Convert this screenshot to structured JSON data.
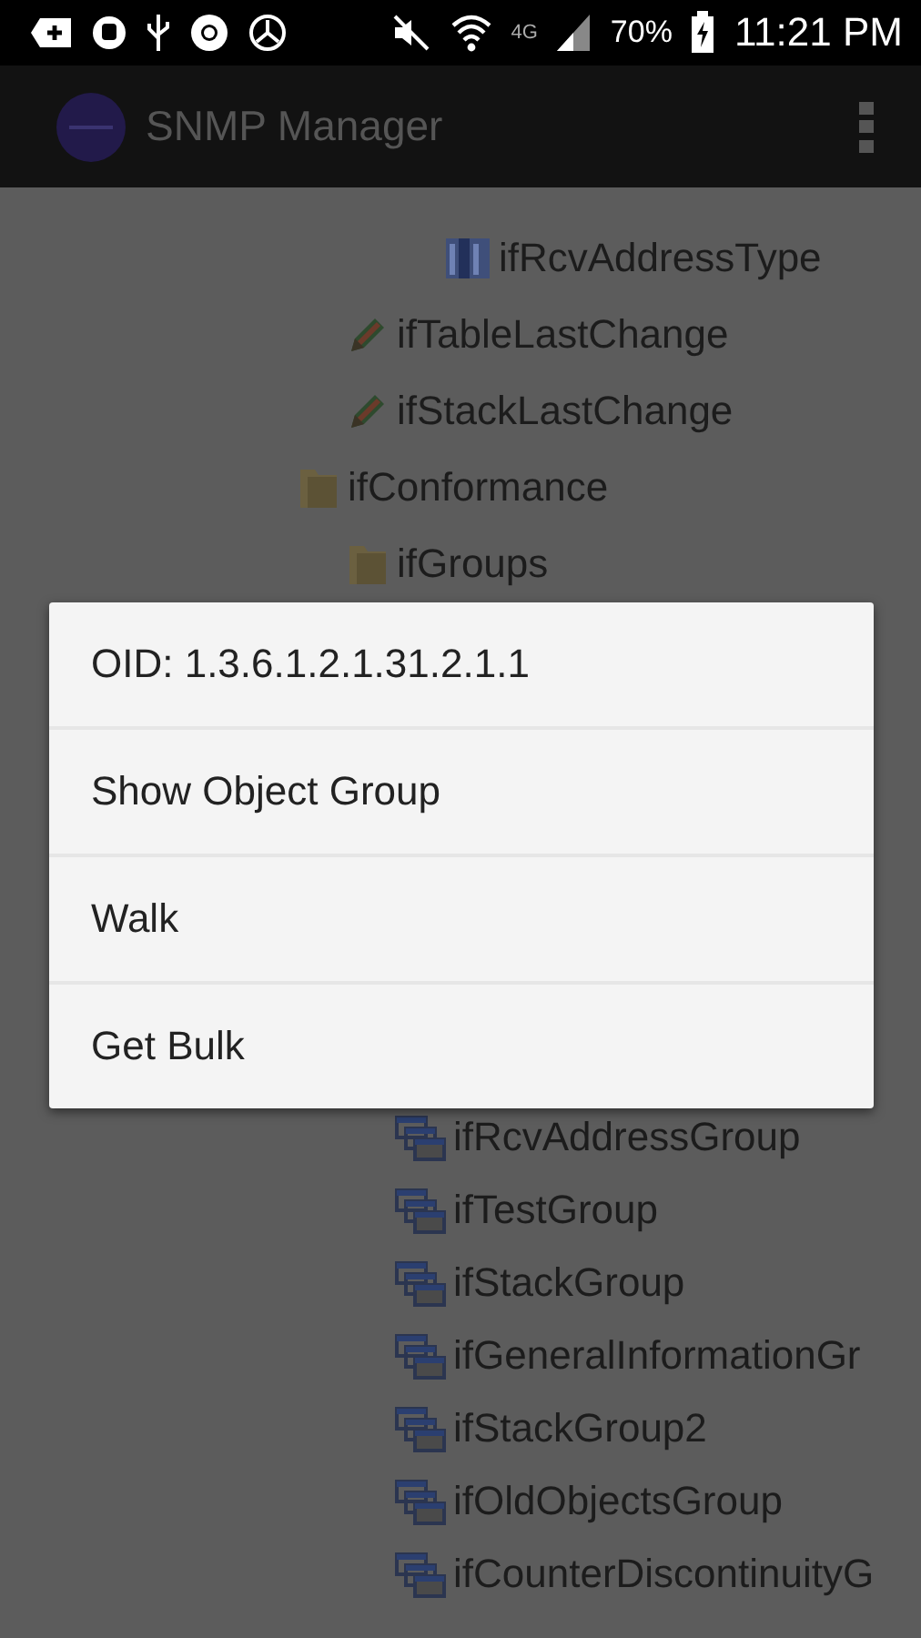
{
  "status_bar": {
    "network": "4G",
    "battery": "70%",
    "time": "11:21 PM"
  },
  "app_bar": {
    "title": "SNMP Manager"
  },
  "tree": [
    {
      "children": [
        {
          "children": [
            {
              "children": [
                {
                  "label": "ifRcvAddressType",
                  "kind": "column"
                }
              ]
            }
          ]
        },
        {
          "label": "ifTableLastChange",
          "kind": "scalar"
        },
        {
          "label": "ifStackLastChange",
          "kind": "scalar"
        }
      ]
    },
    {
      "label": "ifConformance",
      "kind": "folder",
      "children": [
        {
          "label": "ifGroups",
          "kind": "folder",
          "children": [
            {
              "label": "ifRcvAddressGroup",
              "kind": "group"
            },
            {
              "label": "ifTestGroup",
              "kind": "group"
            },
            {
              "label": "ifStackGroup",
              "kind": "group"
            },
            {
              "label": "ifGeneralInformationGr",
              "kind": "group"
            },
            {
              "label": "ifStackGroup2",
              "kind": "group"
            },
            {
              "label": "ifOldObjectsGroup",
              "kind": "group"
            },
            {
              "label": "ifCounterDiscontinuityG",
              "kind": "group"
            }
          ]
        }
      ]
    }
  ],
  "menu": {
    "items": [
      {
        "label": "OID: 1.3.6.1.2.1.31.2.1.1",
        "kind": "header"
      },
      {
        "label": "Show Object Group",
        "kind": "action"
      },
      {
        "label": "Walk",
        "kind": "action"
      },
      {
        "label": "Get Bulk",
        "kind": "action"
      }
    ]
  }
}
